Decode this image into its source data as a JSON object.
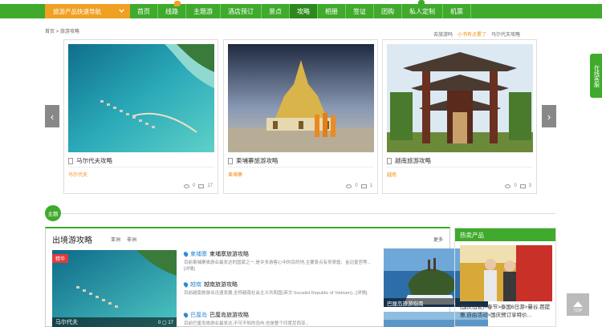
{
  "nav": {
    "category": "旅游产品快速导航",
    "items": [
      "首页",
      "线路",
      "主题游",
      "酒店预订",
      "景点",
      "攻略",
      "相册",
      "签证",
      "团购",
      "私人定制",
      "机票"
    ],
    "active_index": 5
  },
  "breadcrumb": {
    "home": "首页",
    "sep": " > ",
    "current": "旅游攻略"
  },
  "toplinks": {
    "a": "去旅游吗",
    "b": "小书有点累了",
    "c": "马尔代夫攻略"
  },
  "carousel": {
    "prev": "‹",
    "next": "›",
    "cards": [
      {
        "title": "马尔代夫攻略",
        "tag": "马尔代夫",
        "views": "0",
        "comments": "17"
      },
      {
        "title": "柬埔寨旅游攻略",
        "tag": "柬埔寨",
        "views": "0",
        "comments": "1"
      },
      {
        "title": "越南旅游攻略",
        "tag": "越南",
        "views": "0",
        "comments": "3"
      }
    ]
  },
  "side_float": {
    "label": "在线客服"
  },
  "section": {
    "badge": "主题",
    "panel_title": "出境游攻略",
    "tabs": [
      "亚洲",
      "非洲"
    ],
    "more": "更多",
    "featured": {
      "hot": "精华",
      "caption": "马尔代夫",
      "views": "0",
      "comments": "17"
    },
    "articles": [
      {
        "place": "柬埔寨",
        "title": "柬埔寨旅游攻略",
        "desc": "目前柬埔寨旅游业最发达的国家之一,是许多游客心中的目的地,主要景点有吴哥窟、金边皇宫等...[详情]"
      },
      {
        "place": "越南",
        "title": "越南旅游攻略",
        "desc": "目前越南旅游业迅速发展,全称越南社会主义共和国(英文:Socialist Republic of Vietnam)...[详情]"
      },
      {
        "place": "巴厘岛",
        "title": "巴厘岛旅游攻略",
        "desc": "目前巴厘岛旅游业最发达,不可不知的岛屿,也是整个印度尼西亚..."
      }
    ],
    "side_images": [
      {
        "caption": "巴厘岛旅游指南"
      },
      {
        "caption": ""
      }
    ]
  },
  "hot_products": {
    "header": "热卖产品",
    "text": "(国庆出发)<春节>泰国6日游>曼谷,芭提雅,自由活动>国庆预订享特价..."
  },
  "to_top": "TOP"
}
